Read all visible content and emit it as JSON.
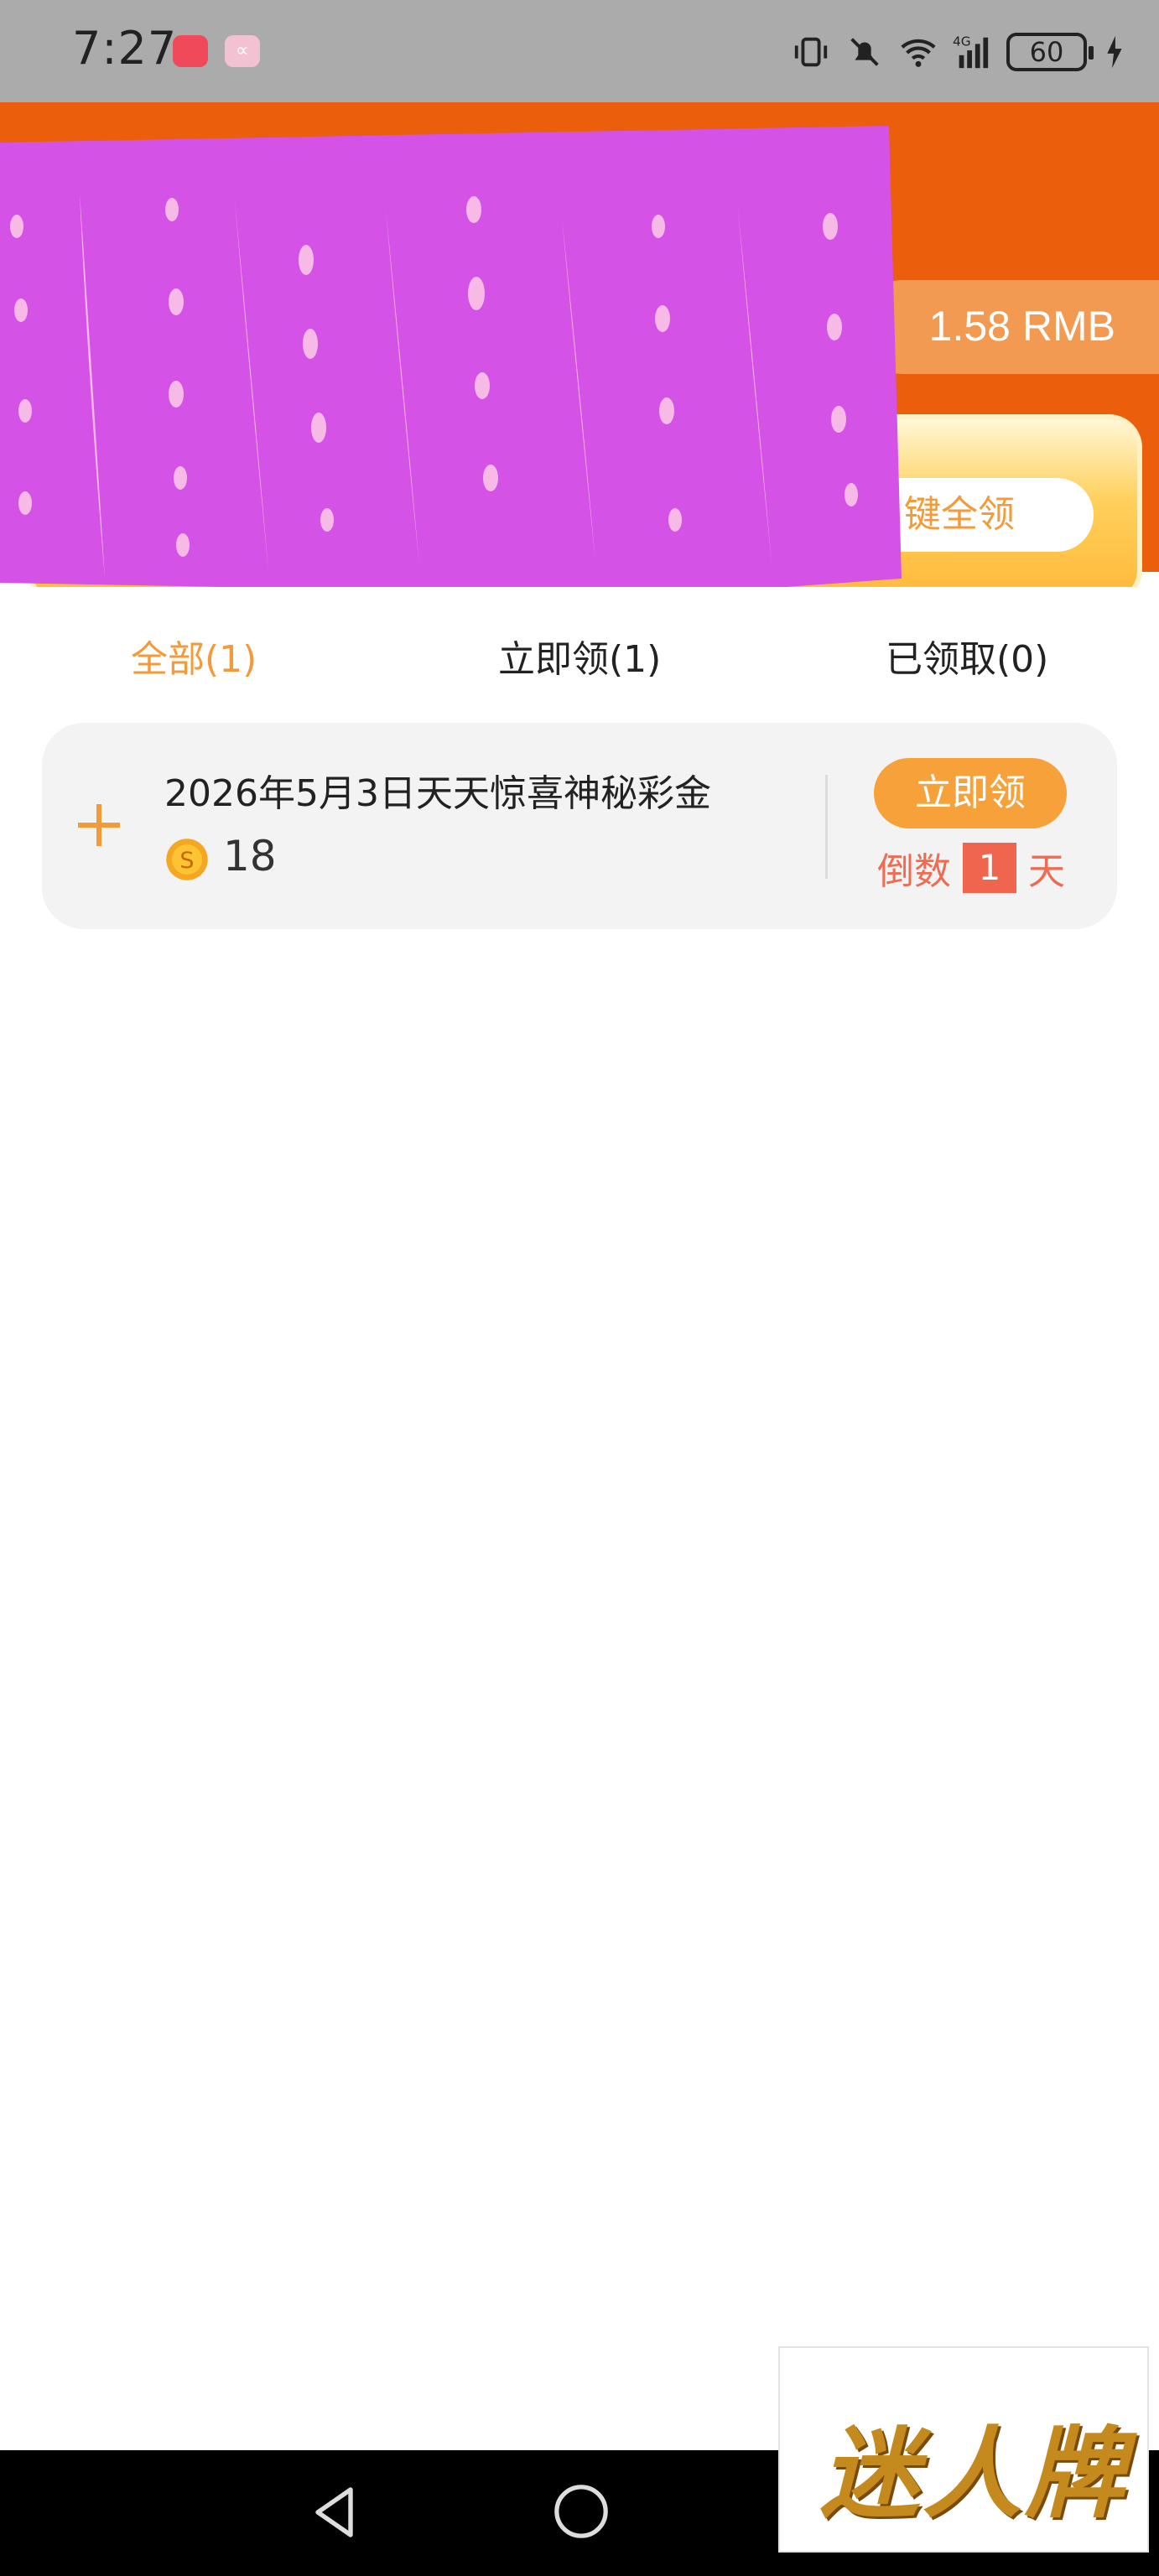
{
  "status_bar": {
    "time": "7:27",
    "network": "4G",
    "battery": "60"
  },
  "header": {
    "balance": "1.58 RMB",
    "claim_all_label": "键全领"
  },
  "tabs": [
    {
      "label": "全部(1)",
      "active": true
    },
    {
      "label": "立即领(1)",
      "active": false
    },
    {
      "label": "已领取(0)",
      "active": false
    }
  ],
  "reward": {
    "title": "2026年5月3日天天惊喜神秘彩金",
    "amount": "18",
    "claim_label": "立即领",
    "countdown_prefix": "倒数",
    "countdown_value": "1",
    "countdown_unit": "天"
  },
  "watermark": {
    "text": "迷人牌"
  },
  "colors": {
    "header_orange": "#ea5e0c",
    "accent_orange": "#f39a3a",
    "claim_button": "#f7a13a",
    "countdown_red": "#ef6b52",
    "scribble_purple": "#d552e6"
  }
}
